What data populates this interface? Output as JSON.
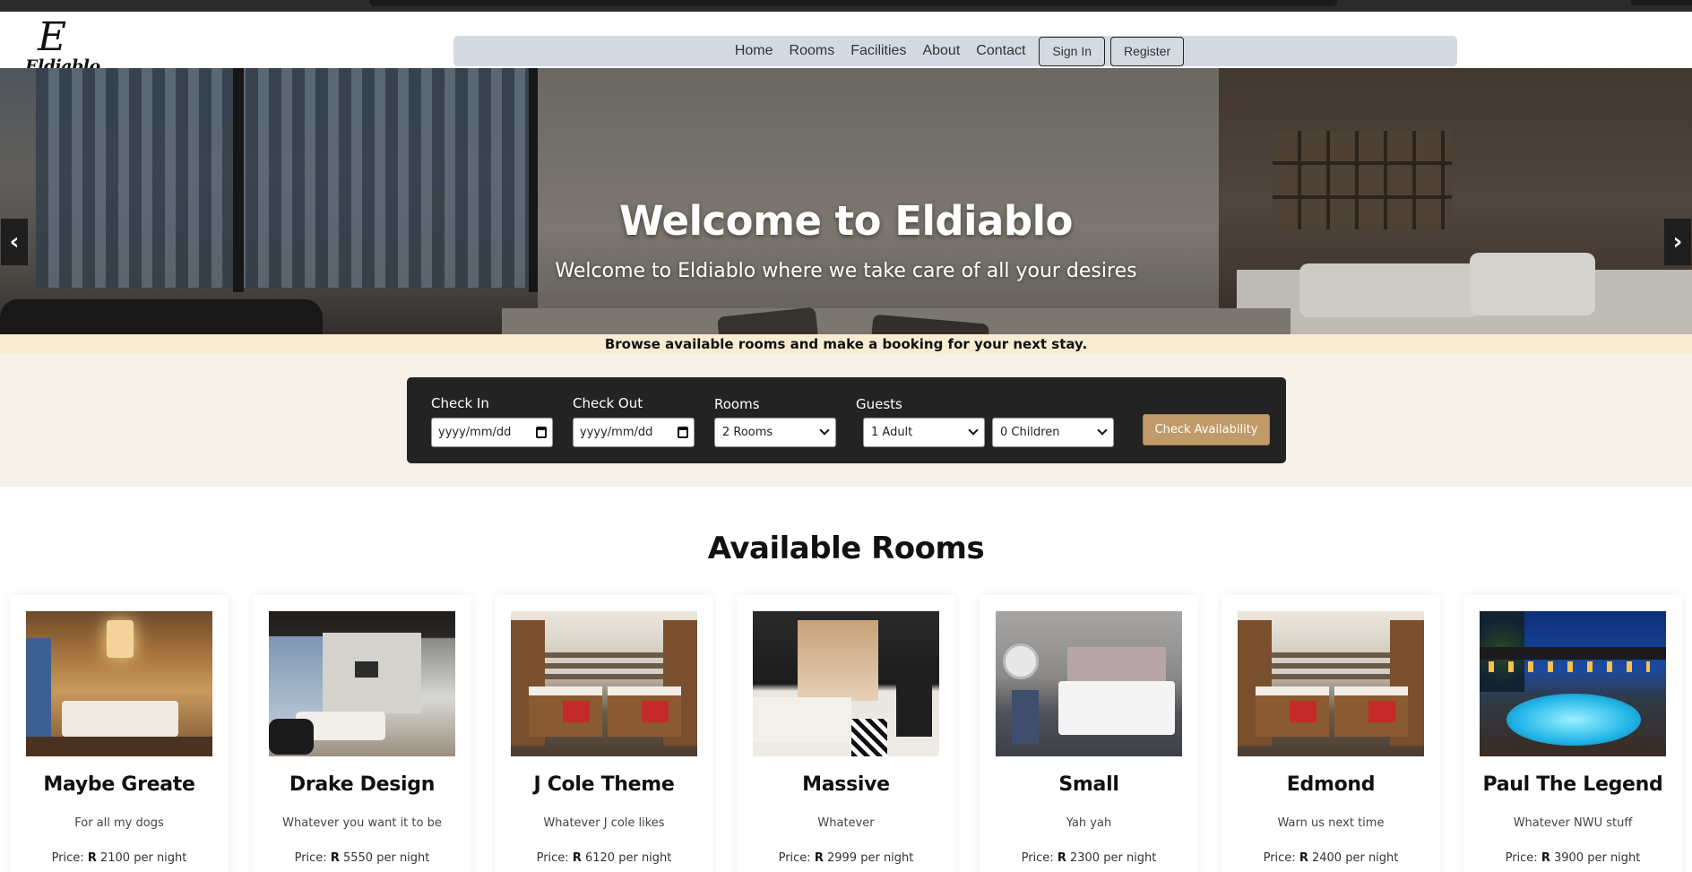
{
  "brand": {
    "logo_mark": "E",
    "logo_word": "Eldiablo"
  },
  "nav": {
    "links": [
      "Home",
      "Rooms",
      "Facilities",
      "About",
      "Contact"
    ],
    "sign_in": "Sign In",
    "register": "Register"
  },
  "hero": {
    "title": "Welcome to Eldiablo",
    "subtitle": "Welcome to Eldiablo where we take care of all your desires",
    "prev_icon": "chevron-left-icon",
    "next_icon": "chevron-right-icon",
    "prev_glyph": "‹",
    "next_glyph": "›"
  },
  "tagline": "Browse available rooms and make a booking for your next stay.",
  "booking": {
    "check_in_label": "Check In",
    "check_in_value": "yyyy/mm/dd",
    "check_out_label": "Check Out",
    "check_out_value": "yyyy/mm/dd",
    "rooms_label": "Rooms",
    "rooms_value": "2 Rooms",
    "guests_label": "Guests",
    "adults_value": "1 Adult",
    "children_value": "0 Children",
    "submit_label": "Check Availability"
  },
  "rooms_section": {
    "heading": "Available Rooms",
    "price_prefix": "Price:",
    "currency": "R",
    "price_suffix": "per night",
    "cards": [
      {
        "title": "Maybe Greate",
        "desc": "For all my dogs",
        "price": "2100"
      },
      {
        "title": "Drake Design",
        "desc": "Whatever you want it to be",
        "price": "5550"
      },
      {
        "title": "J Cole Theme",
        "desc": "Whatever J cole likes",
        "price": "6120"
      },
      {
        "title": "Massive",
        "desc": "Whatever",
        "price": "2999"
      },
      {
        "title": "Small",
        "desc": "Yah yah",
        "price": "2300"
      },
      {
        "title": "Edmond",
        "desc": "Warn us next time",
        "price": "2400"
      },
      {
        "title": "Paul The Legend",
        "desc": "Whatever NWU stuff",
        "price": "3900"
      }
    ]
  },
  "colors": {
    "navbar_bg": "#d3dae2",
    "tagline_bg": "#f8ecd2",
    "booking_bg": "#232323",
    "accent_button": "#c09a68"
  }
}
